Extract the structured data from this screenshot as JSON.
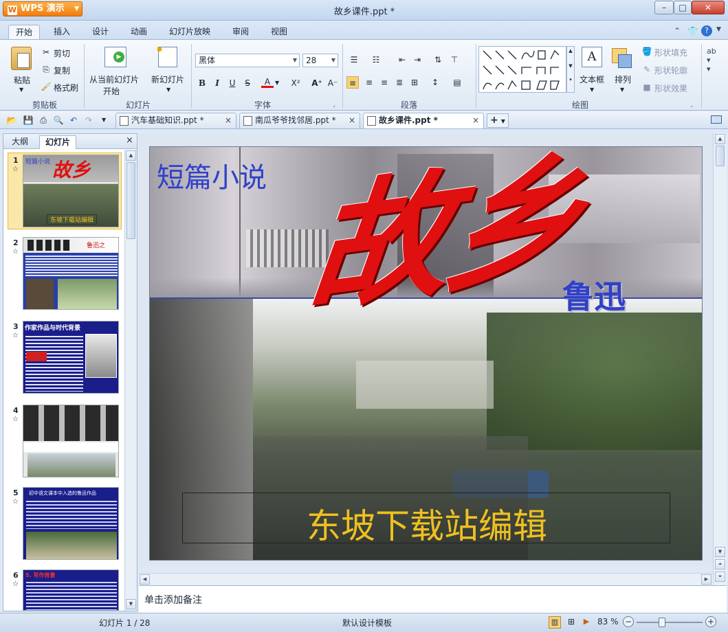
{
  "app": {
    "menu_button": "WPS 演示",
    "window_title": "故乡课件.ppt *"
  },
  "window_controls": {
    "minimize": "–",
    "maximize": "□",
    "close": "✕"
  },
  "ribbon_tabs": [
    "开始",
    "插入",
    "设计",
    "动画",
    "幻灯片放映",
    "审阅",
    "视图"
  ],
  "ribbon": {
    "clipboard": {
      "paste": "粘贴",
      "cut": "剪切",
      "copy": "复制",
      "format_painter": "格式刷",
      "group": "剪贴板"
    },
    "slides": {
      "from_current_1": "从当前幻灯片",
      "from_current_2": "开始",
      "new_slide": "新幻灯片",
      "group": "幻灯片"
    },
    "font": {
      "font_name": "黑体",
      "font_size": "28",
      "bold": "B",
      "italic": "I",
      "underline": "U",
      "strike": "S",
      "font_color": "A",
      "superscript": "X²",
      "grow": "A⁺",
      "shrink": "A⁻",
      "group": "字体"
    },
    "paragraph": {
      "group": "段落"
    },
    "drawing": {
      "textbox": "文本框",
      "arrange": "排列",
      "shape_fill": "形状填充",
      "shape_outline": "形状轮廓",
      "shape_effect": "形状效果",
      "group": "绘图"
    }
  },
  "doc_tabs": [
    {
      "label": "汽车基础知识.ppt *",
      "active": false
    },
    {
      "label": "南瓜爷爷找邻居.ppt *",
      "active": false
    },
    {
      "label": "故乡课件.ppt *",
      "active": true
    }
  ],
  "left_panel": {
    "tabs": [
      "大纲",
      "幻灯片"
    ],
    "slides": [
      {
        "num": "1",
        "label_top": "短篇小说",
        "title": "故乡",
        "caption": "东坡下载站编辑"
      },
      {
        "num": "2",
        "label_top": "鲁迅之"
      },
      {
        "num": "3",
        "label_top": "作家作品与时代背景"
      },
      {
        "num": "4",
        "label_top": ""
      },
      {
        "num": "5",
        "label_top": "初中语文课本中入选的鲁迅作品"
      },
      {
        "num": "6",
        "label_top": "5. 写作背景"
      }
    ]
  },
  "slide": {
    "subtitle": "短篇小说",
    "title": "故乡",
    "author": "鲁迅",
    "caption": "东坡下载站编辑"
  },
  "notes_placeholder": "单击添加备注",
  "status": {
    "slide_counter": "幻灯片 1 / 28",
    "template": "默认设计模板",
    "zoom": "83 %"
  },
  "colors": {
    "accent_orange": "#f07c10",
    "title_red": "#e01010",
    "subtitle_blue": "#3040c8",
    "caption_yellow": "#f0c020"
  }
}
